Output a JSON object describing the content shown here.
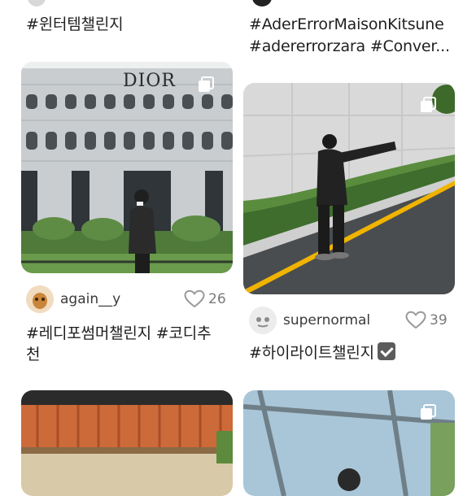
{
  "top_left": {
    "caption": "#윈터템챌린지"
  },
  "top_right": {
    "caption_line1": "#AderErrorMaisonKitsune",
    "caption_line2": "#adererrorzara #Conver..."
  },
  "post_left": {
    "image_alt": "Person standing in front of DIOR building",
    "sign_text": "DIOR",
    "username": "again__y",
    "likes": "26",
    "caption_line1": "#레디포썸머챌린지 #코디추",
    "caption_line2": "천"
  },
  "post_right": {
    "image_alt": "Person in black jacket posing on sloped street",
    "username": "supernormal",
    "likes": "39",
    "caption": "#하이라이트챌린지"
  },
  "bottom_left": {
    "image_alt": "Building with orange tile roof"
  },
  "bottom_right": {
    "image_alt": "Person under glass canopy"
  },
  "colors": {
    "accent_yellow": "#f0b400",
    "heart_outline": "#9a9a9a"
  }
}
